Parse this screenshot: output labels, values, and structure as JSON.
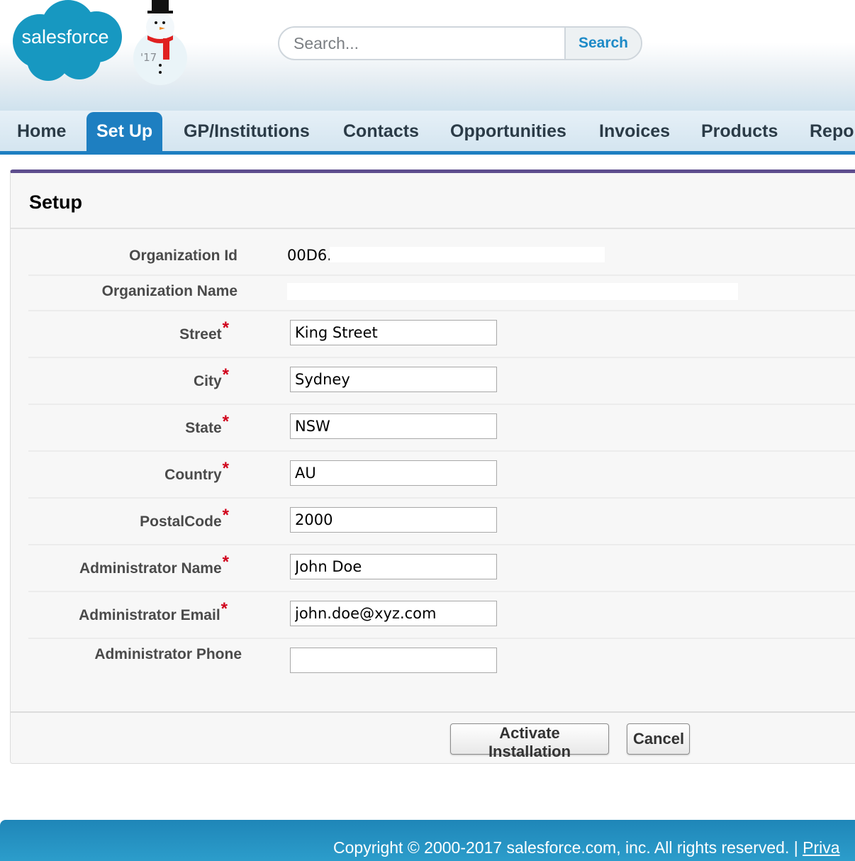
{
  "brand": {
    "logo_text": "salesforce",
    "year_badge": "'17",
    "cloud_color": "#1798c1",
    "accent_color": "#1e7fc1"
  },
  "search": {
    "placeholder": "Search...",
    "button_label": "Search"
  },
  "nav": {
    "tabs": [
      {
        "label": "Home",
        "active": false
      },
      {
        "label": "Set Up",
        "active": true
      },
      {
        "label": "GP/Institutions",
        "active": false
      },
      {
        "label": "Contacts",
        "active": false
      },
      {
        "label": "Opportunities",
        "active": false
      },
      {
        "label": "Invoices",
        "active": false
      },
      {
        "label": "Products",
        "active": false
      },
      {
        "label": "Repo",
        "active": false
      }
    ]
  },
  "setup": {
    "title": "Setup",
    "org_id": {
      "label": "Organization Id",
      "value": "00D6."
    },
    "org_name": {
      "label": "Organization Name",
      "value": ""
    },
    "fields": [
      {
        "label": "Street",
        "required": true,
        "value": "King Street"
      },
      {
        "label": "City",
        "required": true,
        "value": "Sydney"
      },
      {
        "label": "State",
        "required": true,
        "value": "NSW"
      },
      {
        "label": "Country",
        "required": true,
        "value": "AU"
      },
      {
        "label": "PostalCode",
        "required": true,
        "value": "2000"
      },
      {
        "label": "Administrator Name",
        "required": true,
        "value": "John Doe"
      },
      {
        "label": "Administrator Email",
        "required": true,
        "value": "john.doe@xyz.com"
      },
      {
        "label": "Administrator Phone",
        "required": false,
        "value": ""
      }
    ],
    "required_marker": "*",
    "buttons": {
      "activate": "Activate Installation",
      "cancel": "Cancel"
    }
  },
  "footer": {
    "copyright": "Copyright © 2000-2017 salesforce.com, inc. All rights reserved. |",
    "privacy_link": "Priva"
  }
}
